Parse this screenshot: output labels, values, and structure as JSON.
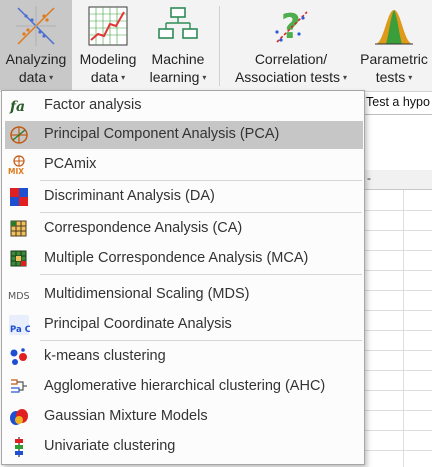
{
  "ribbon": {
    "buttons": [
      {
        "line1": "Analyzing",
        "line2": "data",
        "icon": "pca-scatter-icon",
        "active": true
      },
      {
        "line1": "Modeling",
        "line2": "data",
        "icon": "line-chart-icon",
        "active": false
      },
      {
        "line1": "Machine",
        "line2": "learning",
        "icon": "tree-diagram-icon",
        "active": false
      },
      {
        "line1": "Correlation/",
        "line2": "Association tests",
        "icon": "question-scatter-icon",
        "active": false
      },
      {
        "line1": "Parametric",
        "line2": "tests",
        "icon": "normal-curve-icon",
        "active": false
      }
    ],
    "caret": "▾"
  },
  "sheet": {
    "hint": "Test a hypo",
    "col_header_mark": "-"
  },
  "menu": {
    "items": [
      {
        "label": "Factor analysis",
        "icon": "fa-icon",
        "selected": false
      },
      {
        "label": "Principal Component Analysis (PCA)",
        "icon": "pca-target-icon",
        "selected": true
      },
      {
        "label": "PCAmix",
        "icon": "pcamix-icon",
        "icon_text": "MIX",
        "selected": false
      },
      {
        "label": "Discriminant Analysis (DA)",
        "icon": "da-icon",
        "selected": false
      },
      {
        "label": "Correspondence Analysis (CA)",
        "icon": "ca-grid-icon",
        "selected": false
      },
      {
        "label": "Multiple Correspondence Analysis (MCA)",
        "icon": "mca-grid-icon",
        "selected": false
      },
      {
        "label": "Multidimensional Scaling (MDS)",
        "icon": "mds-icon",
        "icon_text": "MDS",
        "selected": false
      },
      {
        "label": "Principal Coordinate Analysis",
        "icon": "pco-icon",
        "icon_text": "Pa Co",
        "selected": false
      },
      {
        "label": "k-means clustering",
        "icon": "kmeans-icon",
        "selected": false
      },
      {
        "label": "Agglomerative hierarchical clustering (AHC)",
        "icon": "dendrogram-icon",
        "selected": false
      },
      {
        "label": "Gaussian Mixture Models",
        "icon": "gmm-icon",
        "selected": false
      },
      {
        "label": "Univariate clustering",
        "icon": "univariate-icon",
        "selected": false
      }
    ]
  },
  "colors": {
    "ribbon_bg": "#f3f3f3",
    "active_button": "#c8c8c8",
    "menu_selected": "#c6c6c6",
    "accent_red": "#e02020",
    "accent_blue": "#1f4fd1",
    "accent_green": "#2e9e2e"
  }
}
